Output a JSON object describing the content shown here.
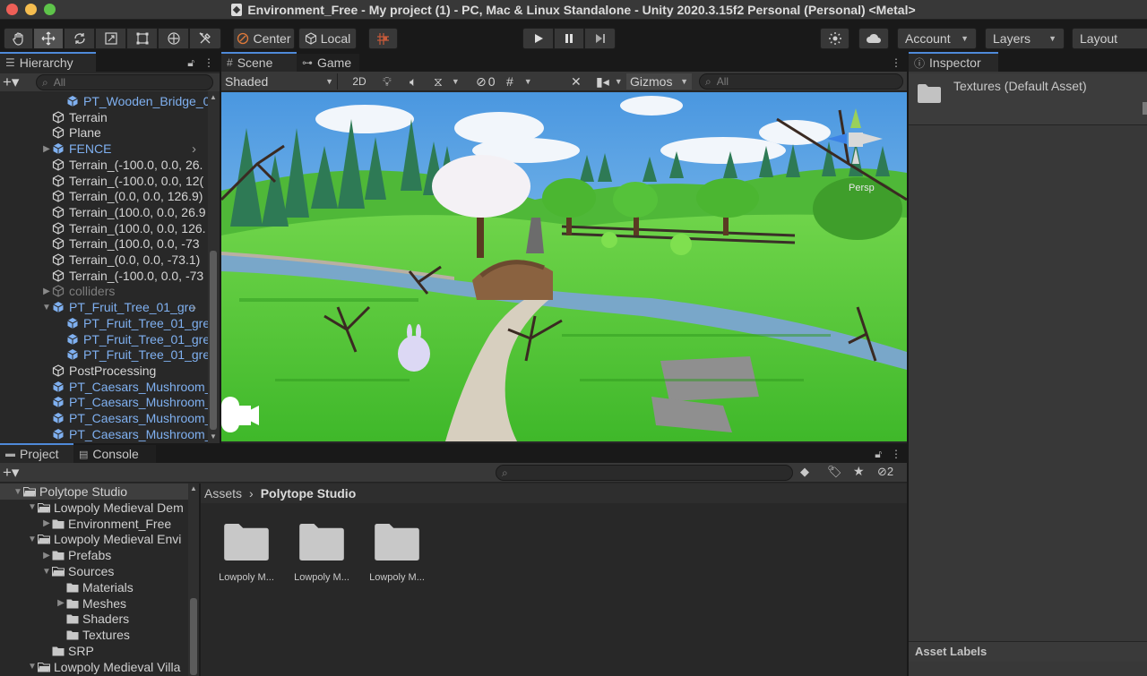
{
  "window": {
    "title": "Environment_Free - My project (1) - PC, Mac & Linux Standalone - Unity 2020.3.15f2 Personal (Personal) <Metal>"
  },
  "toolbar": {
    "pivot_label": "Center",
    "space_label": "Local",
    "account_label": "Account",
    "layers_label": "Layers",
    "layout_label": "Layout"
  },
  "hierarchy": {
    "tab_label": "Hierarchy",
    "search_placeholder": "All",
    "items": [
      {
        "label": "PT_Wooden_Bridge_0",
        "color": "blue",
        "indent": 2,
        "icon": "prefab"
      },
      {
        "label": "Terrain",
        "color": "white",
        "indent": 1,
        "icon": "gameobject"
      },
      {
        "label": "Plane",
        "color": "white",
        "indent": 1,
        "icon": "gameobject"
      },
      {
        "label": "FENCE",
        "color": "blue",
        "indent": 1,
        "icon": "prefab",
        "arrow": "right",
        "more": true
      },
      {
        "label": "Terrain_(-100.0, 0.0, 26.",
        "color": "white",
        "indent": 1,
        "icon": "gameobject"
      },
      {
        "label": "Terrain_(-100.0, 0.0, 12(",
        "color": "white",
        "indent": 1,
        "icon": "gameobject"
      },
      {
        "label": "Terrain_(0.0, 0.0, 126.9)",
        "color": "white",
        "indent": 1,
        "icon": "gameobject"
      },
      {
        "label": "Terrain_(100.0, 0.0, 26.9",
        "color": "white",
        "indent": 1,
        "icon": "gameobject"
      },
      {
        "label": "Terrain_(100.0, 0.0, 126.",
        "color": "white",
        "indent": 1,
        "icon": "gameobject"
      },
      {
        "label": "Terrain_(100.0, 0.0, -73",
        "color": "white",
        "indent": 1,
        "icon": "gameobject"
      },
      {
        "label": "Terrain_(0.0, 0.0, -73.1)",
        "color": "white",
        "indent": 1,
        "icon": "gameobject"
      },
      {
        "label": "Terrain_(-100.0, 0.0, -73",
        "color": "white",
        "indent": 1,
        "icon": "gameobject"
      },
      {
        "label": "colliders",
        "color": "grey",
        "indent": 1,
        "icon": "gameobject",
        "arrow": "right"
      },
      {
        "label": "PT_Fruit_Tree_01_gre",
        "color": "blue",
        "indent": 1,
        "icon": "prefab",
        "arrow": "down",
        "more": true
      },
      {
        "label": "PT_Fruit_Tree_01_gree",
        "color": "blue",
        "indent": 2,
        "icon": "prefab"
      },
      {
        "label": "PT_Fruit_Tree_01_gree",
        "color": "blue",
        "indent": 2,
        "icon": "prefab"
      },
      {
        "label": "PT_Fruit_Tree_01_gree",
        "color": "blue",
        "indent": 2,
        "icon": "prefab"
      },
      {
        "label": "PostProcessing",
        "color": "white",
        "indent": 1,
        "icon": "gameobject"
      },
      {
        "label": "PT_Caesars_Mushroom_",
        "color": "blue",
        "indent": 1,
        "icon": "prefab"
      },
      {
        "label": "PT_Caesars_Mushroom_",
        "color": "blue",
        "indent": 1,
        "icon": "prefab"
      },
      {
        "label": "PT_Caesars_Mushroom_",
        "color": "blue",
        "indent": 1,
        "icon": "prefab"
      },
      {
        "label": "PT_Caesars_Mushroom_",
        "color": "blue",
        "indent": 1,
        "icon": "prefab"
      }
    ]
  },
  "scene": {
    "tab_scene": "Scene",
    "tab_game": "Game",
    "shading_mode": "Shaded",
    "mode_2d": "2D",
    "hidden_count": "0",
    "gizmos_label": "Gizmos",
    "search_placeholder": "All",
    "persp_label": "Persp"
  },
  "project": {
    "tab_project": "Project",
    "tab_console": "Console",
    "hidden_count": "2",
    "breadcrumb_root": "Assets",
    "breadcrumb_current": "Polytope Studio",
    "tree": [
      {
        "label": "Polytope Studio",
        "indent": 0,
        "arrow": "down",
        "selected": true
      },
      {
        "label": "Lowpoly Medieval Dem",
        "indent": 1,
        "arrow": "down"
      },
      {
        "label": "Environment_Free",
        "indent": 2,
        "arrow": "right"
      },
      {
        "label": "Lowpoly Medieval Envi",
        "indent": 1,
        "arrow": "down"
      },
      {
        "label": "Prefabs",
        "indent": 2,
        "arrow": "right"
      },
      {
        "label": "Sources",
        "indent": 2,
        "arrow": "down"
      },
      {
        "label": "Materials",
        "indent": 3,
        "arrow": ""
      },
      {
        "label": "Meshes",
        "indent": 3,
        "arrow": "right"
      },
      {
        "label": "Shaders",
        "indent": 3,
        "arrow": ""
      },
      {
        "label": "Textures",
        "indent": 3,
        "arrow": ""
      },
      {
        "label": "SRP",
        "indent": 2,
        "arrow": ""
      },
      {
        "label": "Lowpoly Medieval Villa",
        "indent": 1,
        "arrow": "down"
      }
    ],
    "folders": [
      "Lowpoly M...",
      "Lowpoly M...",
      "Lowpoly M..."
    ]
  },
  "inspector": {
    "tab_label": "Inspector",
    "asset_title": "Textures (Default Asset)",
    "asset_labels": "Asset Labels"
  }
}
